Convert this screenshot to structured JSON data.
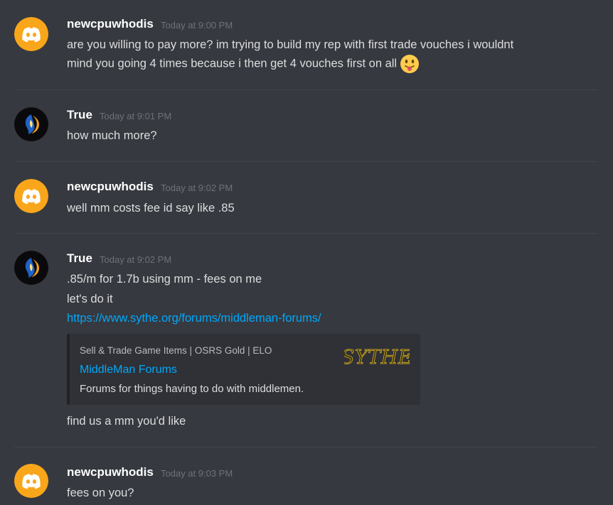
{
  "colors": {
    "background": "#36393f",
    "discord_avatar": "#faa61a",
    "link": "#00a8fc",
    "embed_bg": "#2f3136"
  },
  "messages": [
    {
      "author": "newcpuwhodis",
      "avatar": "discord-logo-avatar",
      "timestamp": "Today at 9:00 PM",
      "lines": [
        "are you willing to pay more? im trying to build my rep with first trade vouches i wouldnt",
        "mind you going 4 times because i then get 4 vouches first on all"
      ],
      "emoji": "tongue-out-emoji"
    },
    {
      "author": "True",
      "avatar": "dark-orb-avatar",
      "timestamp": "Today at 9:01 PM",
      "lines": [
        "how much more?"
      ]
    },
    {
      "author": "newcpuwhodis",
      "avatar": "discord-logo-avatar",
      "timestamp": "Today at 9:02 PM",
      "lines": [
        "well mm costs fee id say like .85"
      ]
    },
    {
      "author": "True",
      "avatar": "dark-orb-avatar",
      "timestamp": "Today at 9:02 PM",
      "lines": [
        ".85/m for 1.7b using mm - fees on me",
        "let's do it"
      ],
      "link": "https://www.sythe.org/forums/middleman-forums/",
      "embed": {
        "provider": "Sell & Trade Game Items | OSRS Gold | ELO",
        "title": "MiddleMan Forums",
        "description": "Forums for things having to do with middlemen.",
        "thumbnail_text": "SYTHE"
      },
      "after_embed": "find us a mm you'd like"
    },
    {
      "author": "newcpuwhodis",
      "avatar": "discord-logo-avatar",
      "timestamp": "Today at 9:03 PM",
      "lines": [
        "fees on you?"
      ]
    }
  ]
}
